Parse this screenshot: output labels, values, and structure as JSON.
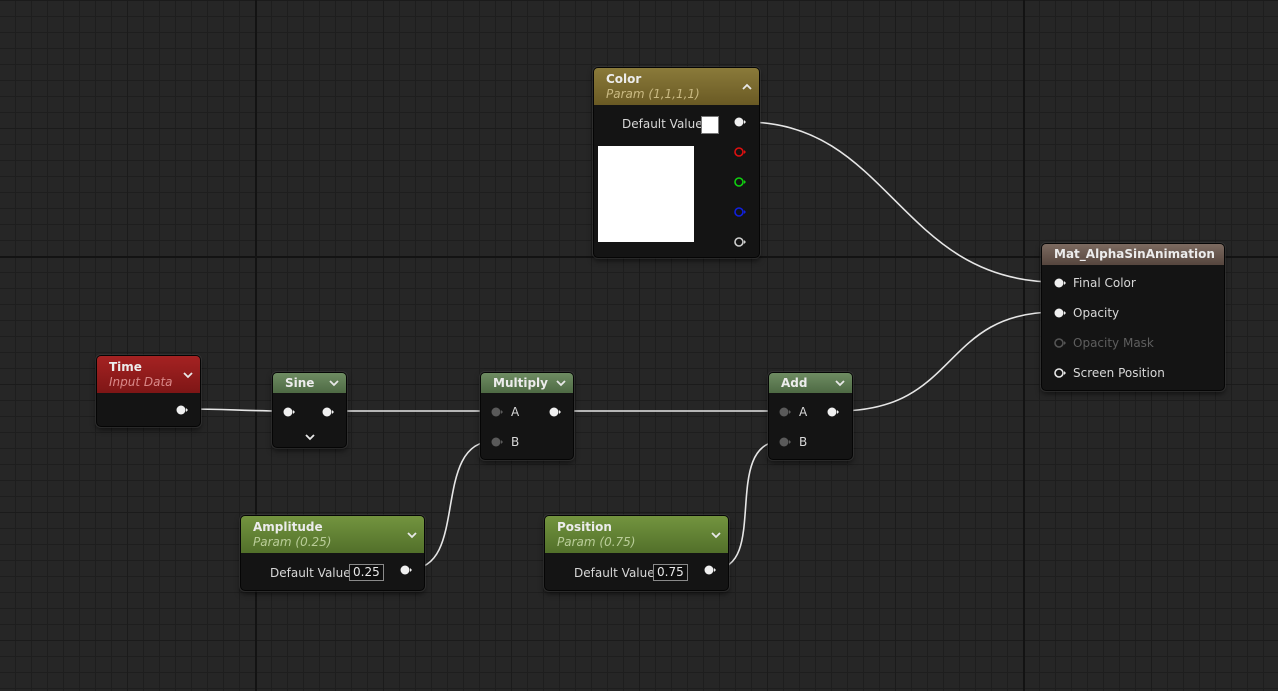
{
  "nodes": {
    "color": {
      "title": "Color",
      "subtitle": "Param (1,1,1,1)",
      "default_label": "Default Value",
      "swatch": "#ffffff"
    },
    "time": {
      "title": "Time",
      "subtitle": "Input Data"
    },
    "sine": {
      "title": "Sine"
    },
    "multiply": {
      "title": "Multiply",
      "pin_a": "A",
      "pin_b": "B"
    },
    "add": {
      "title": "Add",
      "pin_a": "A",
      "pin_b": "B"
    },
    "amplitude": {
      "title": "Amplitude",
      "subtitle": "Param (0.25)",
      "default_label": "Default Value",
      "value": "0.25"
    },
    "position": {
      "title": "Position",
      "subtitle": "Param (0.75)",
      "default_label": "Default Value",
      "value": "0.75"
    },
    "material": {
      "title": "Mat_AlphaSinAnimation",
      "inputs": [
        "Final Color",
        "Opacity",
        "Opacity Mask",
        "Screen Position"
      ]
    }
  },
  "colors": {
    "param_header": "#6b8a3a",
    "vector_param_header": "#7a6a2a",
    "input_header": "#9a1e1e",
    "math_header": "#5c7a52",
    "material_header": "#6a5a52",
    "pin_red": "#e01010",
    "pin_green": "#10d010",
    "pin_blue": "#1020e0",
    "wire": "#e6e6e6"
  }
}
